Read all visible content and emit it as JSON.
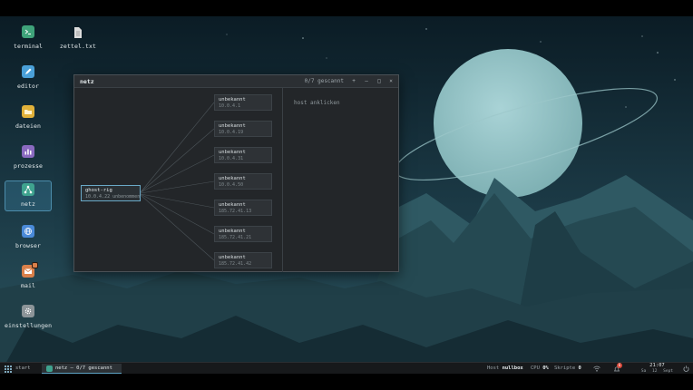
{
  "desktop": {
    "icons": [
      {
        "label": "terminal",
        "icon": "terminal-icon",
        "color": "#3fa37a"
      },
      {
        "label": "zettel.txt",
        "icon": "text-file-icon",
        "color": "#dcdcdc"
      },
      {
        "label": "editor",
        "icon": "editor-icon",
        "color": "#4aa0d8"
      },
      {
        "label": "dateien",
        "icon": "folder-icon",
        "color": "#e0b13a"
      },
      {
        "label": "prozesse",
        "icon": "chart-icon",
        "color": "#8a6ac0"
      },
      {
        "label": "netz",
        "icon": "network-icon",
        "color": "#3fa38f"
      },
      {
        "label": "browser",
        "icon": "globe-icon",
        "color": "#4a8ad8"
      },
      {
        "label": "mail",
        "icon": "mail-icon",
        "color": "#d9804a"
      },
      {
        "label": "einstellungen",
        "icon": "gear-icon",
        "color": "#8c9498"
      }
    ]
  },
  "window": {
    "title": "netz",
    "status": "0/7 gescannt",
    "buttons": {
      "pin": "+",
      "minimize": "–",
      "maximize": "□",
      "close": "×"
    },
    "center": {
      "name": "ghost-rig",
      "info": "10.0.4.22 unbenommen"
    },
    "nodes": [
      {
        "name": "unbekannt",
        "ip": "10.0.4.1"
      },
      {
        "name": "unbekannt",
        "ip": "10.0.4.19"
      },
      {
        "name": "unbekannt",
        "ip": "10.0.4.31"
      },
      {
        "name": "unbekannt",
        "ip": "10.0.4.50"
      },
      {
        "name": "unbekannt",
        "ip": "185.72.41.13"
      },
      {
        "name": "unbekannt",
        "ip": "185.72.41.21"
      },
      {
        "name": "unbekannt",
        "ip": "185.72.41.42"
      }
    ],
    "detail_hint": "host anklicken"
  },
  "taskbar": {
    "start_label": "start",
    "task_label": "netz — 0/7 gescannt",
    "host_label": "Host",
    "host_value": "nullbox",
    "cpu_label": "CPU",
    "cpu_value": "0%",
    "scripts_label": "Skripte",
    "scripts_value": "0",
    "notif_count": "6",
    "time": "21:07",
    "date": "Sa 12 Sept",
    "accent": "#5fa3c5"
  }
}
